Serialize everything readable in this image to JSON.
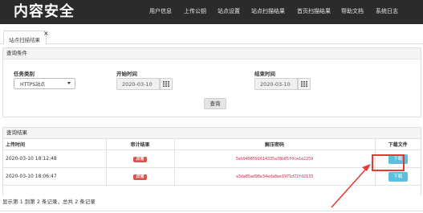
{
  "navbar": {
    "brand": "内容安全",
    "items": [
      "用户信息",
      "上传公钥",
      "站点设置",
      "站点扫描结果",
      "首页扫描结果",
      "帮助文档",
      "系统日志"
    ]
  },
  "tabs": [
    {
      "label": "站点扫描结果",
      "close": "×"
    }
  ],
  "query_panel": {
    "title": "查询条件",
    "task_type_label": "任务类别",
    "task_type_value": "HTTPS站点",
    "start_label": "开始时间",
    "start_value": "2020-03-10",
    "end_label": "结束时间",
    "end_value": "2020-03-10",
    "query_button": "查询"
  },
  "results_panel": {
    "title": "查询结果",
    "columns": [
      "上传时间",
      "审计结果",
      "解压密码",
      "下载文件"
    ],
    "rows": [
      {
        "time": "2020-03-10 18:12:48",
        "status": "异常",
        "password": "5eb9408591614335a78b85f0ce1e2259",
        "action": "下载"
      },
      {
        "time": "2020-03-10 18:06:47",
        "status": "异常",
        "password": "a3da85ad98e34eda8ee1971d72fd2133",
        "action": "下载"
      }
    ],
    "summary": "显示第 1 到第 2 条记录，总共 2 条记录"
  },
  "colors": {
    "navbar_bg": "#2b2b2b",
    "badge_danger": "#d9534f",
    "download_btn": "#5bc0de",
    "annotation": "#e53935"
  }
}
